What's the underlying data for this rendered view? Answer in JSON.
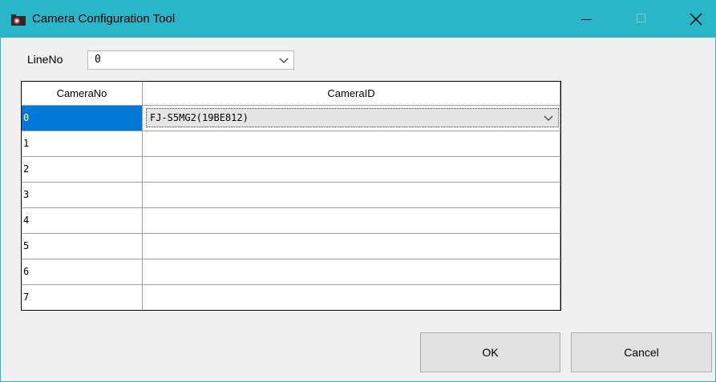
{
  "window": {
    "title": "Camera Configuration Tool",
    "icon": "camera-icon"
  },
  "titlebar_buttons": [
    "minimize-icon",
    "maximize-icon",
    "close-icon"
  ],
  "line": {
    "label": "LineNo",
    "selected": "0"
  },
  "grid": {
    "columns": [
      "CameraNo",
      "CameraID"
    ],
    "rows": [
      {
        "no": "0",
        "id": "FJ-S5MG2(19BE812)",
        "selected": true
      },
      {
        "no": "1",
        "id": ""
      },
      {
        "no": "2",
        "id": ""
      },
      {
        "no": "3",
        "id": ""
      },
      {
        "no": "4",
        "id": ""
      },
      {
        "no": "5",
        "id": ""
      },
      {
        "no": "6",
        "id": ""
      },
      {
        "no": "7",
        "id": ""
      }
    ]
  },
  "buttons": {
    "ok": "OK",
    "cancel": "Cancel"
  },
  "colors": {
    "titlebar": "#2bb5c9",
    "selection": "#0078d7"
  }
}
